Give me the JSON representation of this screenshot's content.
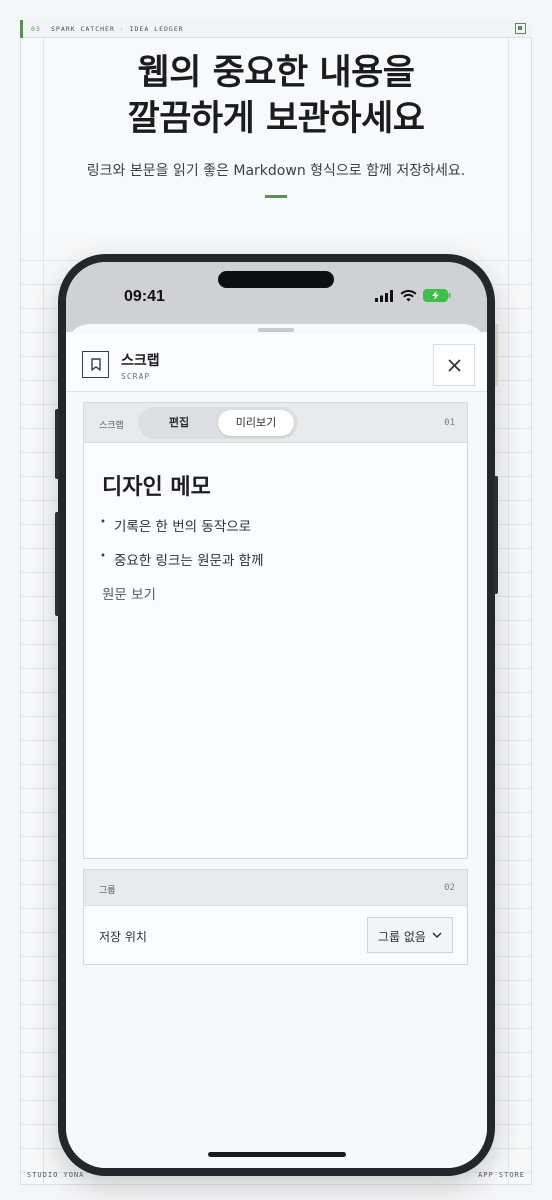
{
  "topbar": {
    "page": "03",
    "crumb": "SPARK CATCHER · IDEA LEDGER"
  },
  "hero": {
    "line1": "웹의 중요한 내용을",
    "line2": "깔끔하게 보관하세요",
    "subtitle": "링크와 본문을 읽기 좋은 Markdown 형식으로 함께 저장하세요."
  },
  "footer": {
    "left": "STUDIO YONA",
    "right": "APP STORE"
  },
  "phone": {
    "time": "09:41",
    "sheet": {
      "title": "스크랩",
      "subtitle": "SCRAP",
      "close_icon": "close-icon"
    },
    "scrap_card": {
      "label": "스크랩",
      "tabs": [
        "편집",
        "미리보기"
      ],
      "selected_tab": "미리보기",
      "number": "01",
      "preview": {
        "heading": "디자인 메모",
        "bullets": [
          "기록은 한 번의 동작으로",
          "중요한 링크는 원문과 함께"
        ],
        "link": "원문 보기"
      }
    },
    "group_card": {
      "label": "그룹",
      "number": "02",
      "field_label": "저장 위치",
      "selected": "그룹 없음"
    }
  },
  "colors": {
    "accent": "#5f8a59",
    "battery": "#3dbf4a"
  }
}
